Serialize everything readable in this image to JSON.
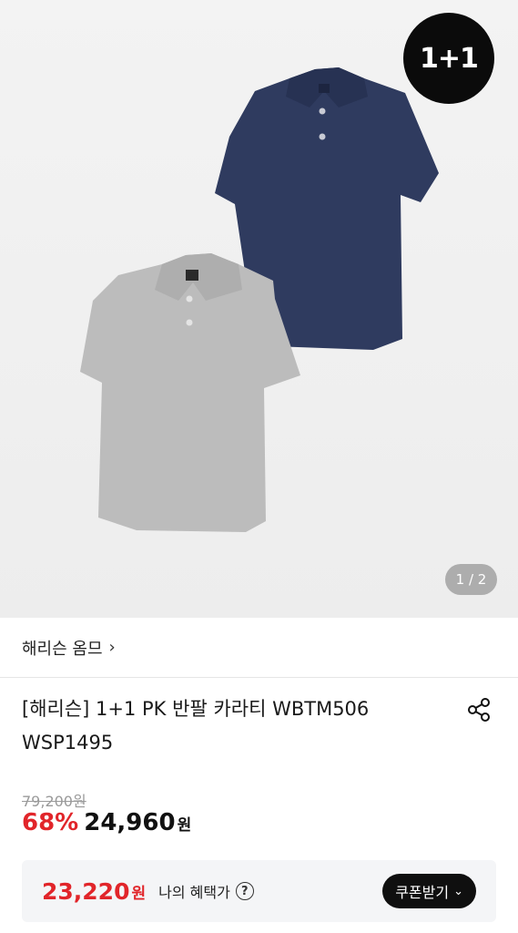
{
  "gallery": {
    "badge": "1+1",
    "page_indicator": "1 / 2",
    "colors": {
      "navy": "#2e3a5e",
      "gray": "#b9b9b9"
    }
  },
  "brand": {
    "name": "해리슨 옴므",
    "chevron": "›"
  },
  "product": {
    "title": "[해리슨] 1+1 PK 반팔 카라티 WBTM506 WSP1495",
    "original_price": "79,200원",
    "discount": "68%",
    "sale_price": "24,960",
    "sale_unit": "원"
  },
  "benefit": {
    "price": "23,220",
    "unit": "원",
    "label": "나의 혜택가",
    "help": "?",
    "coupon_button": "쿠폰받기",
    "coupon_chevron": "⌄"
  },
  "icons": {
    "share": "share-icon"
  },
  "theme": {
    "accent_red": "#e1252a",
    "dark": "#0f0f0f"
  }
}
